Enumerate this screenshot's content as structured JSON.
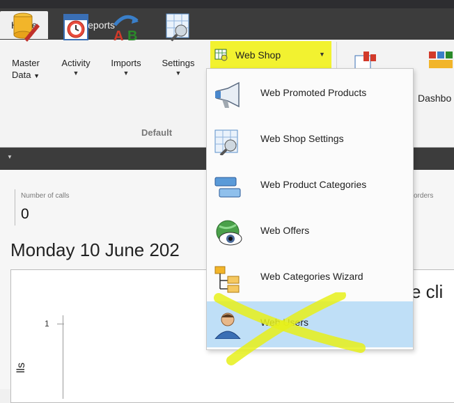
{
  "tabs": [
    {
      "label": "Home",
      "active": true
    },
    {
      "label": "Reports",
      "active": false
    }
  ],
  "ribbon": {
    "buttons": [
      {
        "label_line1": "Master",
        "label_line2": "Data",
        "icon": "database-pencil-icon"
      },
      {
        "label_line1": "Activity",
        "label_line2": "",
        "icon": "calendar-clock-icon"
      },
      {
        "label_line1": "Imports",
        "label_line2": "",
        "icon": "import-ab-icon"
      },
      {
        "label_line1": "Settings",
        "label_line2": "",
        "icon": "settings-table-icon"
      }
    ],
    "group_label": "Default",
    "partial_right_label": "Dashbo",
    "webshop": {
      "label": "Web Shop",
      "icon": "webshop-icon",
      "highlight_color": "#f2f230"
    }
  },
  "dropdown": {
    "items": [
      {
        "label": "Web Promoted Products",
        "icon": "megaphone-icon"
      },
      {
        "label": "Web Shop Settings",
        "icon": "settings-table-icon"
      },
      {
        "label": "Web Product Categories",
        "icon": "categories-icon"
      },
      {
        "label": "Web Offers",
        "icon": "globe-eye-icon"
      },
      {
        "label": "Web Categories Wizard",
        "icon": "hierarchy-icon"
      },
      {
        "label": "Web Users",
        "icon": "user-icon",
        "highlighted": true
      }
    ]
  },
  "content": {
    "calls_label": "Number of calls",
    "calls_value": "0",
    "orders_label": "orders",
    "date_title": "Monday 10 June 202",
    "chart_title_partial": "e cli",
    "y_tick": "1",
    "y_axis_label_partial": "lls"
  },
  "colors": {
    "highlight_yellow": "#f2f230",
    "dark_bar": "#3c3c3c",
    "selected_item": "#bfdff7"
  }
}
